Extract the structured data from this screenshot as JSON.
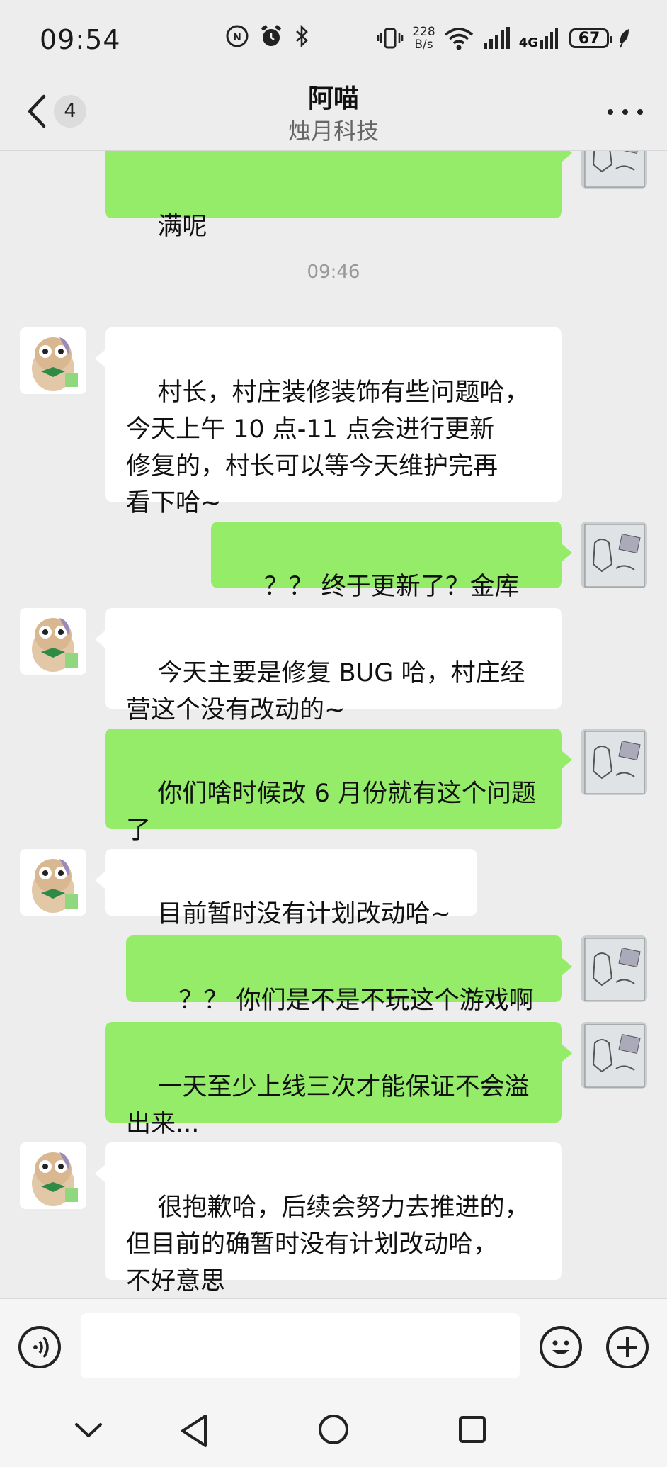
{
  "status_bar": {
    "time": "09:54",
    "net_speed_value": "228",
    "net_speed_unit": "B/s",
    "network_type": "4G",
    "battery": "67"
  },
  "header": {
    "unread_count": "4",
    "title": "阿喵",
    "subtitle": "烛月科技"
  },
  "chat": {
    "timestamp": "09:46",
    "partial_message": "满呢",
    "messages": [
      {
        "from": "other",
        "text": "村长，村庄装修装饰有些问题哈，\n今天上午 10 点-11 点会进行更新\n修复的，村长可以等今天维护完再\n看下哈~"
      },
      {
        "from": "me",
        "text": "？？ 终于更新了？金库呢"
      },
      {
        "from": "other",
        "text": "今天主要是修复 BUG 哈，村庄经\n营这个没有改动的~"
      },
      {
        "from": "me",
        "text": "你们啥时候改 6 月份就有这个问题\n了"
      },
      {
        "from": "other",
        "text": "目前暂时没有计划改动哈~"
      },
      {
        "from": "me",
        "text": "？？ 你们是不是不玩这个游戏啊"
      },
      {
        "from": "me",
        "text": "一天至少上线三次才能保证不会溢\n出来..."
      },
      {
        "from": "other",
        "text": "很抱歉哈，后续会努力去推进的，\n但目前的确暂时没有计划改动哈，\n不好意思"
      }
    ]
  },
  "colors": {
    "background": "#ededed",
    "bubble_mine": "#95ec69",
    "bubble_other": "#ffffff"
  },
  "icons": {
    "voice": "voice-icon",
    "emoji": "emoji-icon",
    "plus": "plus-icon",
    "back": "back-chevron-icon",
    "more": "more-dots-icon"
  }
}
